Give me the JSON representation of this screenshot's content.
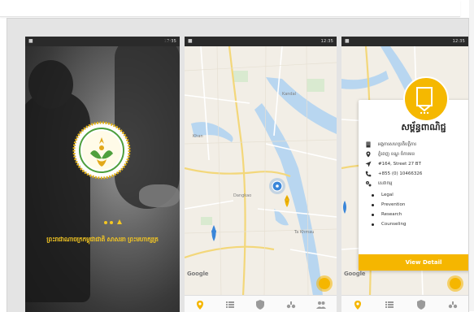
{
  "colors": {
    "accent": "#f5b600",
    "marker_blue": "#3a86d9",
    "status_bar": "#2a2a2a",
    "water": "#b8d6f0"
  },
  "status_bar": {
    "time": "12:35"
  },
  "splash": {
    "title": "ព្រះរាជាណាចក្រកម្ពុជាជាតិ សាសនា ព្រះមហាក្សត្រ"
  },
  "map_screen": {
    "attribution": "Google"
  },
  "detail_screen": {
    "org_name": "សម្ព័ន្ធពាណិជ្ជ",
    "rows": [
      {
        "icon": "building-icon",
        "text": "អង្គការសហប្រតិបត្តិការ"
      },
      {
        "icon": "location-pin-icon",
        "text": "ភ្នំពេញ ខណ្ឌ ចំការមន"
      },
      {
        "icon": "navigation-icon",
        "text": "#164, Street 27 BT"
      },
      {
        "icon": "phone-icon",
        "text": "+855 (0) 10466326"
      },
      {
        "icon": "services-icon",
        "text": "សេវាកម្ម"
      }
    ],
    "services": [
      "Legal",
      "Prevention",
      "Research",
      "Counseling"
    ],
    "view_detail_label": "View Detail"
  }
}
